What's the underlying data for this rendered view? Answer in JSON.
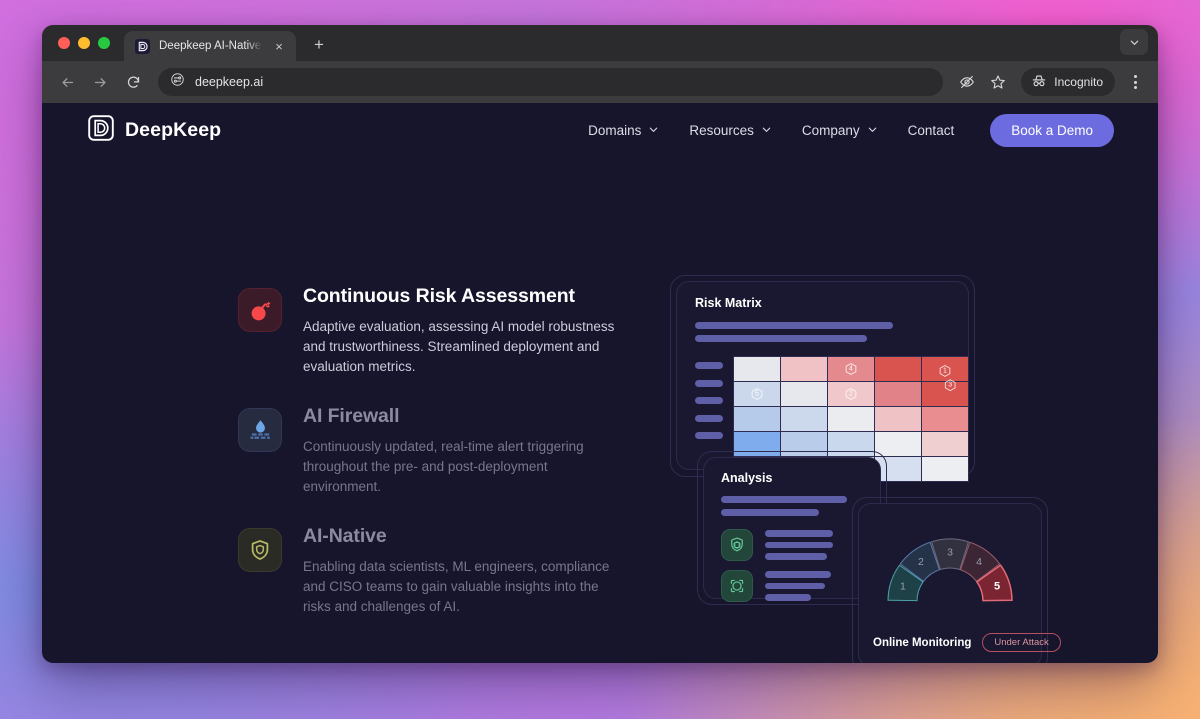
{
  "browser": {
    "tab": {
      "title": "Deepkeep AI-Native Security",
      "favicon": "deepkeep-favicon",
      "close_label": "×",
      "new_tab_label": "+"
    },
    "toolbar": {
      "back": "←",
      "forward": "→",
      "reload": "↻",
      "url": "deepkeep.ai",
      "site_settings_icon": "tune-icon",
      "hide_password_icon": "eye-slash-icon",
      "bookmark_icon": "star-icon",
      "incognito_label": "Incognito",
      "menu_icon": "kebab-menu-icon",
      "window_chevron_icon": "chevron-down-icon"
    }
  },
  "site": {
    "brand": {
      "name": "DeepKeep",
      "logo": "deepkeep-logo"
    },
    "nav": [
      {
        "label": "Domains",
        "has_dropdown": true
      },
      {
        "label": "Resources",
        "has_dropdown": true
      },
      {
        "label": "Company",
        "has_dropdown": true
      },
      {
        "label": "Contact",
        "has_dropdown": false
      }
    ],
    "cta": {
      "label": "Book a Demo",
      "color": "#6c6ce0"
    }
  },
  "features": [
    {
      "id": "continuous-risk-assessment",
      "icon": "bomb-icon",
      "title": "Continuous Risk Assessment",
      "body": "Adaptive evaluation, assessing AI model robustness and trustworthiness. Streamlined deployment and evaluation metrics.",
      "active": true
    },
    {
      "id": "ai-firewall",
      "icon": "firewall-flame-icon",
      "title": "AI Firewall",
      "body": "Continuously updated, real-time alert triggering throughout the pre- and post-deployment environment.",
      "active": false
    },
    {
      "id": "ai-native",
      "icon": "shield-icon",
      "title": "AI-Native",
      "body": "Enabling data scientists, ML engineers, compliance and CISO teams to gain valuable insights into the risks and challenges of AI.",
      "active": false
    }
  ],
  "illustration": {
    "risk_matrix": {
      "title": "Risk Matrix",
      "columns": 5,
      "rows": 5,
      "cells": [
        [
          "#e7e8ed",
          "#f0c2c6",
          "#e48a8f",
          "#d9534f",
          "#d9534f"
        ],
        [
          "#cbd7ea",
          "#e7e8ed",
          "#f0c8cb",
          "#e08287",
          "#d9534f"
        ],
        [
          "#b6cbe9",
          "#ccd9ed",
          "#eaecef",
          "#efc3c6",
          "#ea8d91"
        ],
        [
          "#7facec",
          "#b9cdea",
          "#cad8ee",
          "#eceef1",
          "#f0cfd1"
        ],
        [
          "#78a8ea",
          "#8fb8ec",
          "#c3d4ec",
          "#d6dff0",
          "#eceef1"
        ]
      ],
      "markers": [
        {
          "label": "4",
          "row": 0,
          "col": 2
        },
        {
          "label": "1",
          "row": 0,
          "col": 4
        },
        {
          "label": "3",
          "row": 1,
          "col": 4
        },
        {
          "label": "5",
          "row": 1,
          "col": 0
        },
        {
          "label": "2",
          "row": 1,
          "col": 2
        }
      ]
    },
    "analysis": {
      "title": "Analysis",
      "icons": [
        "shield-chip-icon",
        "scan-circle-icon"
      ]
    },
    "monitoring": {
      "title": "Online Monitoring",
      "status_badge": "Under Attack",
      "gauge_segments": [
        {
          "label": "1",
          "fill": "#1d4147",
          "stroke": "#4fa0a8",
          "active": false
        },
        {
          "label": "2",
          "fill": "#253348",
          "stroke": "#5a77a8",
          "active": false
        },
        {
          "label": "3",
          "fill": "#32313f",
          "stroke": "#6e6a80",
          "active": false
        },
        {
          "label": "4",
          "fill": "#3c2534",
          "stroke": "#9a5a6b",
          "active": false
        },
        {
          "label": "5",
          "fill": "#7a2531",
          "stroke": "#e06a76",
          "active": true
        }
      ]
    }
  }
}
